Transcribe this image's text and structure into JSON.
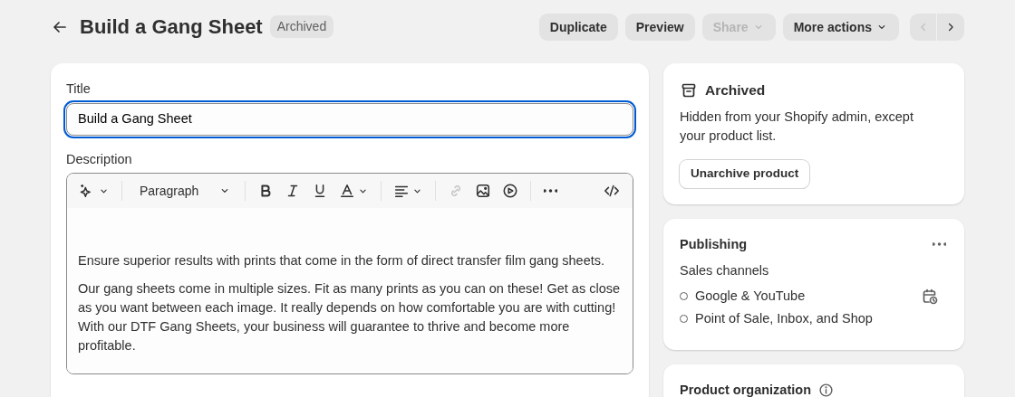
{
  "header": {
    "title": "Build a Gang Sheet",
    "status_badge": "Archived"
  },
  "actions": [
    {
      "label": "Duplicate",
      "disabled": false,
      "dropdown": false
    },
    {
      "label": "Preview",
      "disabled": false,
      "dropdown": false
    },
    {
      "label": "Share",
      "disabled": true,
      "dropdown": true
    },
    {
      "label": "More actions",
      "disabled": false,
      "dropdown": true
    }
  ],
  "pager": {
    "previous_disabled": true,
    "next_disabled": false
  },
  "product": {
    "title_label": "Title",
    "title_value": "Build a Gang Sheet",
    "title_focused": true,
    "description_label": "Description",
    "toolbar": [
      {
        "kind": "magic",
        "disabled": false
      },
      {
        "kind": "format",
        "label": "Paragraph",
        "disabled": false
      },
      {
        "kind": "bold",
        "disabled": false
      },
      {
        "kind": "italic",
        "disabled": false
      },
      {
        "kind": "underline",
        "disabled": false
      },
      {
        "kind": "color",
        "disabled": false
      },
      {
        "kind": "align",
        "disabled": false
      },
      {
        "kind": "link",
        "disabled": true
      },
      {
        "kind": "image",
        "disabled": false
      },
      {
        "kind": "video",
        "disabled": false
      },
      {
        "kind": "more",
        "disabled": false
      },
      {
        "kind": "code",
        "disabled": false
      }
    ],
    "paragraphs": [
      "Ensure superior results with prints that come in the form of direct transfer film gang sheets.",
      "Our gang sheets come in multiple sizes. Fit as many prints as you can on these! Get as close as you want between each image. It really depends on how comfortable you are with cutting! With our DTF Gang Sheets, your business will guarantee to thrive and become more profitable."
    ]
  },
  "status_card": {
    "title": "Archived",
    "text": "Hidden from your Shopify admin, except your product list.",
    "button": "Unarchive product"
  },
  "publishing": {
    "title": "Publishing",
    "subtitle": "Sales channels",
    "channels": [
      {
        "name": "Google & YouTube",
        "published": false,
        "scheduled": true
      },
      {
        "name": "Point of Sale, Inbox, and Shop",
        "published": false,
        "scheduled": false
      }
    ]
  },
  "organization": {
    "title": "Product organization"
  }
}
